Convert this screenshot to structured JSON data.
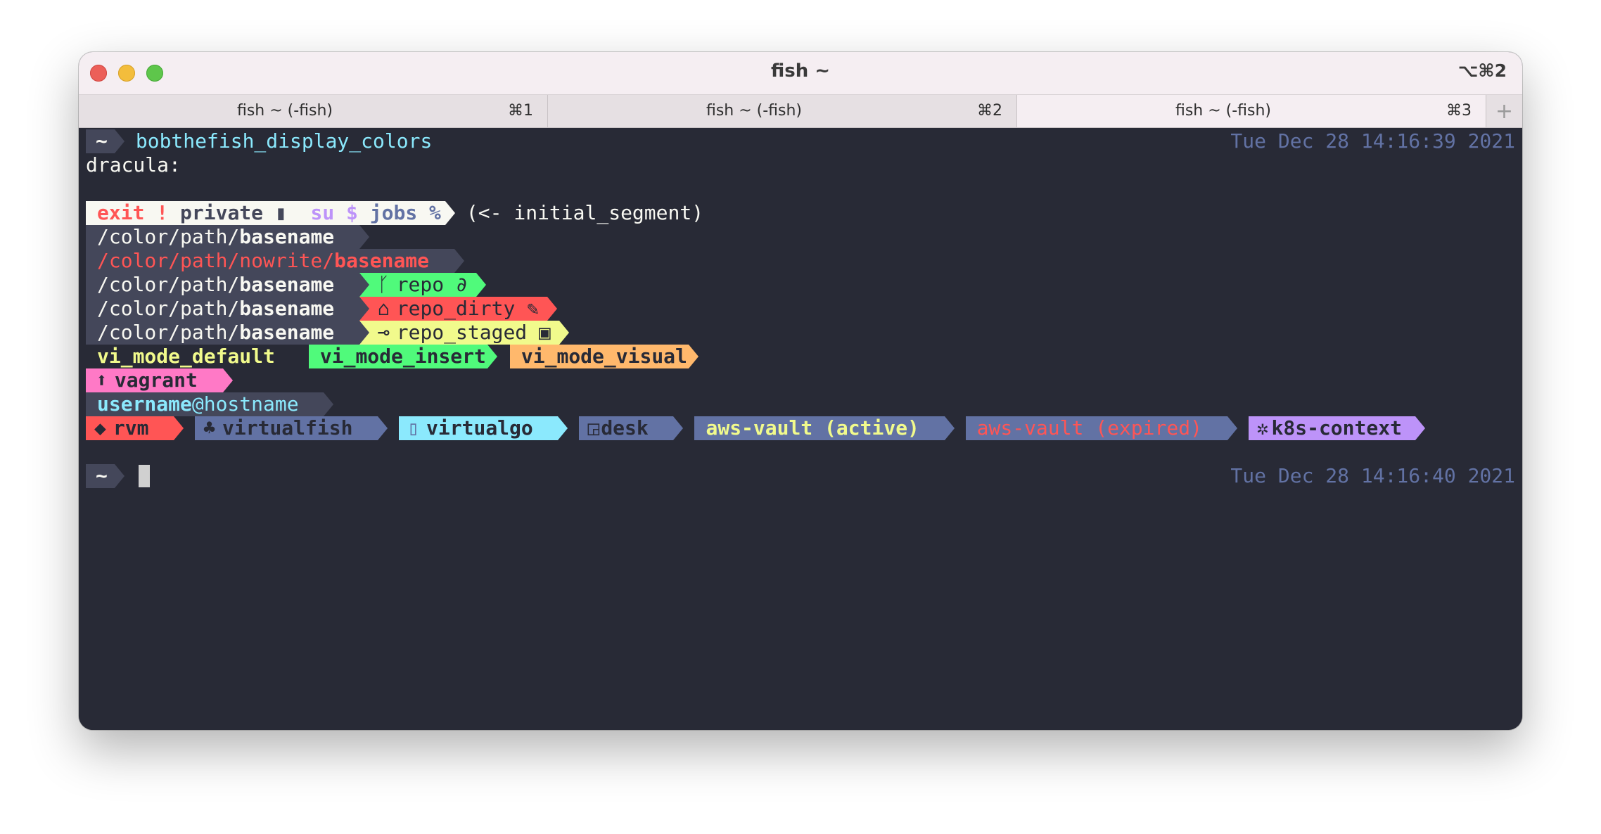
{
  "window": {
    "title": "fish ~",
    "shortcut": "⌥⌘2",
    "tabs": [
      {
        "label": "fish ~ (-fish)",
        "key": "⌘1"
      },
      {
        "label": "fish ~ (-fish)",
        "key": "⌘2"
      },
      {
        "label": "fish ~ (-fish)",
        "key": "⌘3"
      }
    ],
    "add_tab": "+"
  },
  "terminal": {
    "prompt_dir": "~",
    "command": "bobthefish_display_colors",
    "timestamp_1": "Tue Dec 28 14:16:39 2021",
    "timestamp_2": "Tue Dec 28 14:16:40 2021",
    "theme_label": "dracula:",
    "initial_segment": {
      "exit": "exit !",
      "private": "private",
      "su": "su $",
      "jobs": "jobs %",
      "note": "(<- initial_segment)"
    },
    "paths": {
      "path": "/color/path/",
      "basename": "basename",
      "nowrite_path": "/color/path/nowrite/"
    },
    "repo": {
      "repo": "repo",
      "repo_dirty": "repo_dirty",
      "repo_staged": "repo_staged"
    },
    "vi_modes": {
      "default": "vi_mode_default",
      "insert": "vi_mode_insert",
      "visual": "vi_mode_visual"
    },
    "vagrant": "vagrant",
    "user": {
      "username": "username",
      "host": "@hostname"
    },
    "env_segments": {
      "rvm": "rvm",
      "virtualfish": "virtualfish",
      "virtualgo": "virtualgo",
      "desk": "desk",
      "aws_active": "aws-vault (active)",
      "aws_expired": "aws-vault (expired)",
      "k8s": "k8s-context"
    },
    "icons": {
      "lock": "lock-icon",
      "branch": "branch-icon",
      "paperclip": "paperclip-icon",
      "tag": "tag-icon",
      "pencil": "pencil-icon",
      "commit": "commit-icon",
      "save": "save-icon",
      "arrow_up": "arrow-up-icon",
      "ruby": "ruby-icon",
      "fish": "fish-icon",
      "gopher": "gopher-icon",
      "desk": "desk-icon",
      "wheel": "helm-wheel-icon"
    }
  },
  "colors": {
    "background": "#282a36",
    "comment": "#6272a4",
    "current_line": "#44475a",
    "foreground": "#f8f8f2",
    "cyan": "#8be9fd",
    "green": "#50fa7b",
    "orange": "#ffb86c",
    "pink": "#ff79c6",
    "purple": "#bd93f9",
    "red": "#ff5555",
    "yellow": "#f1fa8c"
  }
}
